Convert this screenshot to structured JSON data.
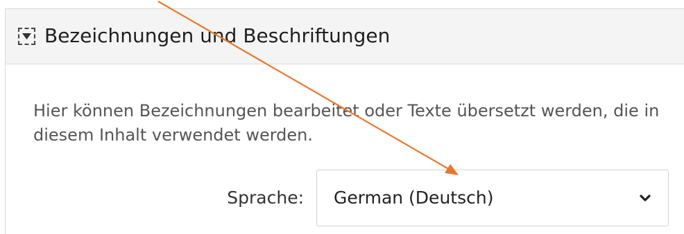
{
  "panel": {
    "title": "Bezeichnungen und Beschriftungen",
    "expanded": true,
    "toggle_icon": "triangle-down-icon",
    "description": "Hier können Bezeichnungen bearbeitet oder Texte übersetzt werden, die in diesem Inhalt verwendet werden."
  },
  "language": {
    "label": "Sprache:",
    "selected": "German (Deutsch)",
    "dropdown_icon": "chevron-down-icon"
  },
  "annotation": {
    "icon": "arrow-annotation",
    "color": "#e8782c"
  },
  "colors": {
    "header_background": "#f4f4f4",
    "border": "#d9d9d9",
    "text": "#555555"
  }
}
